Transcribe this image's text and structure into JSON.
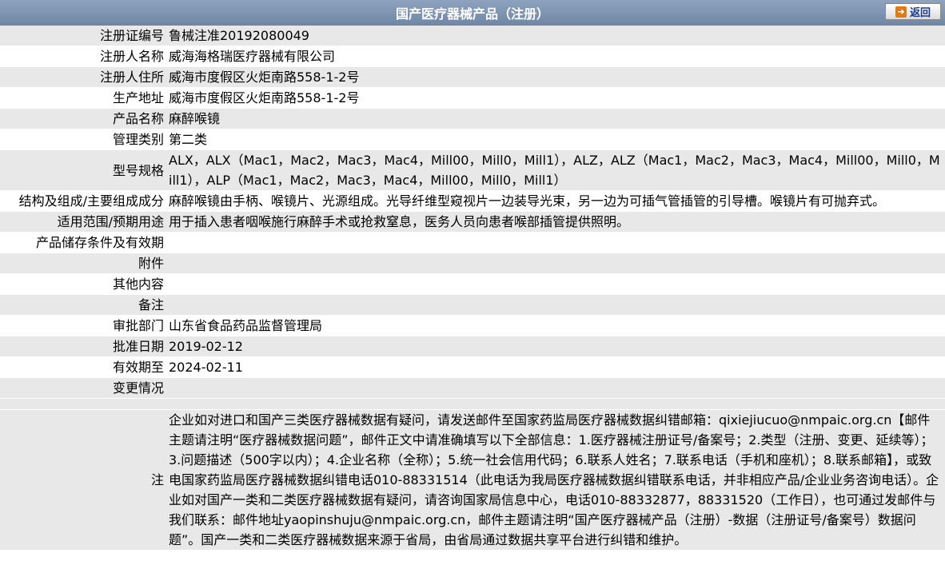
{
  "header": {
    "title": "国产医疗器械产品（注册）",
    "back_label": "返回"
  },
  "rows": [
    {
      "label": "注册证编号",
      "value": "鲁械注准20192080049"
    },
    {
      "label": "注册人名称",
      "value": "威海海格瑞医疗器械有限公司"
    },
    {
      "label": "注册人住所",
      "value": "威海市度假区火炬南路558-1-2号"
    },
    {
      "label": "生产地址",
      "value": "威海市度假区火炬南路558-1-2号"
    },
    {
      "label": "产品名称",
      "value": "麻醉喉镜"
    },
    {
      "label": "管理类别",
      "value": "第二类"
    },
    {
      "label": "型号规格",
      "value": "ALX，ALX（Mac1，Mac2，Mac3，Mac4，Mill00，Mill0，Mill1），ALZ，ALZ（Mac1，Mac2，Mac3，Mac4，Mill00，Mill0，Mill1），ALP（Mac1，Mac2，Mac3，Mac4，Mill00，Mill0，Mill1）"
    },
    {
      "label": "结构及组成/主要组成成分",
      "value": "麻醉喉镜由手柄、喉镜片、光源组成。光导纤维型窥视片一边装导光束，另一边为可插气管插管的引导槽。喉镜片有可抛弃式。"
    },
    {
      "label": "适用范围/预期用途",
      "value": "用于插入患者咽喉施行麻醉手术或抢救窒息，医务人员向患者喉部插管提供照明。"
    },
    {
      "label": "产品储存条件及有效期",
      "value": ""
    },
    {
      "label": "附件",
      "value": ""
    },
    {
      "label": "其他内容",
      "value": ""
    },
    {
      "label": "备注",
      "value": ""
    },
    {
      "label": "审批部门",
      "value": "山东省食品药品监督管理局"
    },
    {
      "label": "批准日期",
      "value": "2019-02-12"
    },
    {
      "label": "有效期至",
      "value": "2024-02-11"
    },
    {
      "label": "变更情况",
      "value": ""
    }
  ],
  "note": {
    "label": "注",
    "value": "企业如对进口和国产三类医疗器械数据有疑问，请发送邮件至国家药监局医疗器械数据纠错邮箱：qixiejiucuo@nmpaic.org.cn【邮件主题请注明“医疗器械数据问题”，邮件正文中请准确填写以下全部信息：1.医疗器械注册证号/备案号；2.类型（注册、变更、延续等）；3.问题描述（500字以内）；4.企业名称（全称）；5.统一社会信用代码；6.联系人姓名；7.联系电话（手机和座机）；8.联系邮箱】，或致电国家药监局医疗器械数据纠错电话010-88331514（此电话为我局医疗器械数据纠错联系电话，并非相应产品/企业业务咨询电话）。企业如对国产一类和二类医疗器械数据有疑问，请咨询国家局信息中心，电话010-88332877，88331520（工作日），也可通过发邮件与我们联系：邮件地址yaopinshuju@nmpaic.org.cn，邮件主题请注明“国产医疗器械产品（注册）-数据（注册证号/备案号）数据问题”。国产一类和二类医疗器械数据来源于省局，由省局通过数据共享平台进行纠错和维护。"
  }
}
